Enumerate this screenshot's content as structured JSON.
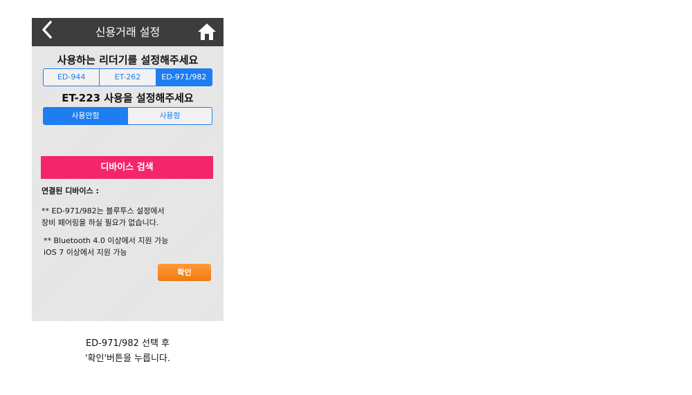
{
  "navbar": {
    "title": "신용거래 설정",
    "back_icon": "chevron-left-icon",
    "home_icon": "home-icon"
  },
  "reader_section": {
    "heading": "사용하는 리더기를 설정해주세요",
    "options": [
      "ED-944",
      "ET-262",
      "ED-971/982"
    ],
    "selected": "ED-971/982"
  },
  "et223_section": {
    "heading": "ET-223 사용을 설정해주세요",
    "options": [
      "사용안함",
      "사용함"
    ],
    "selected": "사용안함"
  },
  "device_search_button": "디바이스 검색",
  "connected_device_label": "연결된 디바이스 :",
  "notes": [
    "** ED-971/982는 블루투스 설정에서\n장비 페어링을 하실 필요가 없습니다.",
    "** Bluetooth 4.0 이상에서 지원 가능\niOS 7 이상에서 지원 가능"
  ],
  "confirm_button": "확인",
  "caption": [
    "ED-971/982 선택 후",
    "'확인'버튼을 누릅니다."
  ],
  "colors": {
    "navbar": "#3d3d3d",
    "accent_blue": "#1e7df0",
    "search_pink": "#f4256b",
    "confirm_orange": "#f0821a"
  }
}
